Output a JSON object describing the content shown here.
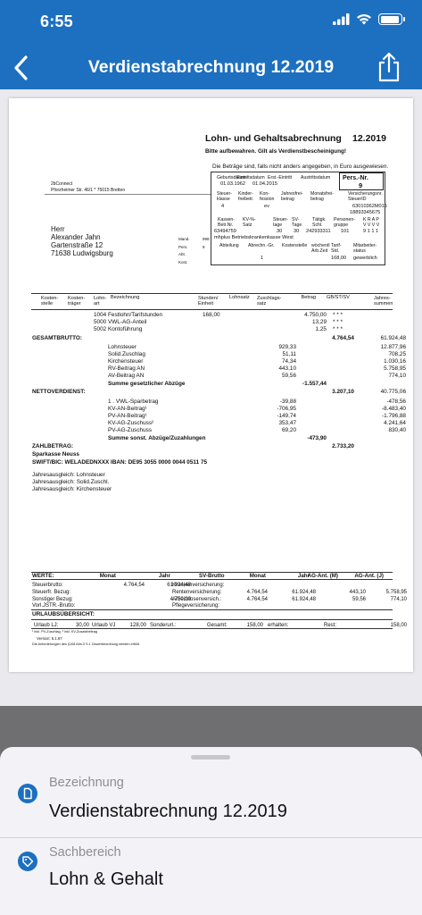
{
  "status_bar": {
    "time": "6:55"
  },
  "nav": {
    "title": "Verdienstabrechnung 12.2019"
  },
  "document": {
    "heading": "Lohn- und Gehaltsabrechnung",
    "period": "12.2019",
    "note": "Bitte aufbewahren. Gilt als Verdienstbescheinigung!",
    "currency_note": "Die Beträge sind, falls nicht anders angegeben, in Euro ausgewiesen.",
    "pers_nr_label": "Pers.-Nr.",
    "pers_nr": "9",
    "sender": "2bConnect",
    "sender_address": "Pforzheimer Str. 46/1 * 75015 Bretten",
    "recipient_salutation": "Herr",
    "recipient_name": "Alexander Jahn",
    "recipient_street": "Gartenstraße 12",
    "recipient_city": "71638 Ludwigsburg",
    "side_labels": [
      "Mand.",
      "Pers.",
      "Abt.",
      "Kost."
    ],
    "side_values": [
      "999",
      "9",
      "",
      ""
    ],
    "info": {
      "h1": [
        "Geburtsdatum",
        "Eintrittsdatum",
        "Erst.-Eintritt",
        "Austrittsdatum"
      ],
      "v1": [
        "01.03.1962",
        "01.04.2015"
      ],
      "h2": [
        "Steuer-\nklasse",
        "Kinder-\nfreibetr.",
        "Kon-\nfession",
        "Jahresfrei-\nbetrag",
        "Monatsfrei-\nbetrag",
        "Versicherungsnr.\nSteuerID"
      ],
      "v2": [
        "4",
        "",
        "ev",
        "",
        "",
        "63010362M015"
      ],
      "steuer_id": "18893345675",
      "h3": [
        "Kassen-\nBetr.Nr.",
        "KV-%-\nSatz",
        "Steuer-\ntage",
        "SV-\nTage",
        "Tätigk.\nSchl.",
        "Personen-\ngruppe",
        "K R A P\nV V V V"
      ],
      "v3": [
        "63494759",
        "",
        "30",
        "30",
        "242933311",
        "101",
        "9 1 1 1"
      ],
      "kasse": "mhplus Betriebskrankenkasse West",
      "h4": [
        "Abteilung",
        "Abrechn.-Gr.",
        "Kostenstelle",
        "wöchentl\nArb.Zeit",
        "Tarif-\nStd.",
        "Mitarbeiter-\nstatus"
      ],
      "v4": [
        "",
        "1",
        "",
        "",
        "168,00",
        "gewerblich"
      ]
    },
    "table_headers": [
      "Kosten-\nstelle",
      "Kosten-\nträger",
      "Lohn-\nart",
      "Bezeichnung",
      "Stunden/\nEinheit",
      "Lohnsatz",
      "Zuschlags-\nsatz",
      "Betrag",
      "GB/ST/SV",
      "Jahres-\nsummen"
    ],
    "earnings": [
      {
        "label": "1004 Festlohn/Tarifstunden",
        "hours": "168,00",
        "amount": "4.750,00",
        "flags": "*  *  *"
      },
      {
        "label": "5000 VWL-AG-Anteil",
        "hours": "",
        "amount": "13,29",
        "flags": "*  *  *"
      },
      {
        "label": "5002 Kontoführung",
        "hours": "",
        "amount": "1,25",
        "flags": "*  *  *"
      }
    ],
    "gross_label": "GESAMTBRUTTO:",
    "gross": "4.764,54",
    "gross_year": "61.924,48",
    "deductions": [
      {
        "label": "Lohnsteuer",
        "value": "929,33",
        "year": "12.877,96"
      },
      {
        "label": "Solid.Zuschlag",
        "value": "51,11",
        "year": "708,25"
      },
      {
        "label": "Kirchensteuer",
        "value": "74,34",
        "year": "1.030,16"
      },
      {
        "label": "RV-Beitrag  AN",
        "value": "443,10",
        "year": "5.758,95"
      },
      {
        "label": "AV-Beitrag  AN",
        "value": "59,56",
        "year": "774,10"
      }
    ],
    "deductions_sum_label": "Summe gesetzlicher Abzüge",
    "deductions_sum": "-1.557,44",
    "net_label": "NETTOVERDIENST:",
    "net": "3.207,10",
    "net_year": "40.775,06",
    "other": [
      {
        "label": "1 . VWL-Sparbetrag",
        "value": "-39,88",
        "year": "-478,56"
      },
      {
        "label": "KV-AN-Beitrag¹",
        "value": "-706,95",
        "year": "-8.483,40"
      },
      {
        "label": "PV-AN-Beitrag¹",
        "value": "-149,74",
        "year": "-1.796,88"
      },
      {
        "label": "KV-AG-Zuschuss²",
        "value": "353,47",
        "year": "4.241,64"
      },
      {
        "label": "PV-AG-Zuschuss",
        "value": "69,20",
        "year": "830,40"
      }
    ],
    "other_sum_label": "Summe sonst. Abzüge/Zuzahlungen",
    "other_sum": "-473,90",
    "payout_label": "ZAHLBETRAG:",
    "payout": "2.733,20",
    "bank": "Sparkasse Neuss",
    "iban_line": "SWIFT/BIC: WELADEDNXXX  IBAN: DE95 3055 0000 0044 0511 75",
    "annual_notes": [
      "Jahresausgleich: Lohnsteuer",
      "Jahresausgleich: Solid.Zuschl.",
      "Jahresausgleich: Kirchensteuer"
    ],
    "summary": {
      "headers": [
        "WERTE:",
        "Monat",
        "Jahr",
        "SV-Brutto",
        "Monat",
        "Jahr",
        "AG-Ant. (M)",
        "AG-Ant. (J)"
      ],
      "rows": [
        [
          "Steuerbrutto:",
          "4.764,54",
          "61.924,48",
          "Krankenversicherung:",
          "",
          "",
          "",
          ""
        ],
        [
          "Steuerfr. Bezug:",
          "",
          "",
          "Rentenversicherung:",
          "4.764,54",
          "61.924,48",
          "443,10",
          "5.758,95"
        ],
        [
          "Sonstiger Bezug:",
          "",
          "4.750,00",
          "Arbeitslosenversich.:",
          "4.764,54",
          "61.924,48",
          "59,56",
          "774,10"
        ],
        [
          "Vorl.JSTR.-Brutto:",
          "",
          "",
          "Pflegeversicherung:",
          "",
          "",
          "",
          ""
        ]
      ],
      "vacation_title": "URLAUBSÜBERSICHT:",
      "vacation": [
        "Urlaub LJ:",
        "30,00",
        "Urlaub VJ",
        "128,00",
        "Sonderurl.:",
        "Gesamt:",
        "158,00",
        "erhalten:",
        "Rest:",
        "158,00"
      ],
      "footnote1": "¹ inkl. PV-Zuschlag, ² inkl. KV-Zusatzbeitrag",
      "version": "Version:  5.1.87",
      "footnote2": "Die Anforderungen des §108 Abs.3 S.1 Gewerbeordnung werden erfüllt."
    }
  },
  "sheet": {
    "field1_label": "Bezeichnung",
    "field1_value": "Verdienstabrechnung 12.2019",
    "field2_label": "Sachbereich",
    "field2_value": "Lohn & Gehalt"
  },
  "colors": {
    "brand": "#1d6fc0",
    "sheet_bg": "#f2f2f7"
  },
  "icons": [
    "back-chevron-icon",
    "share-icon",
    "document-icon",
    "tag-icon",
    "wifi-icon",
    "signal-icon",
    "battery-icon"
  ]
}
